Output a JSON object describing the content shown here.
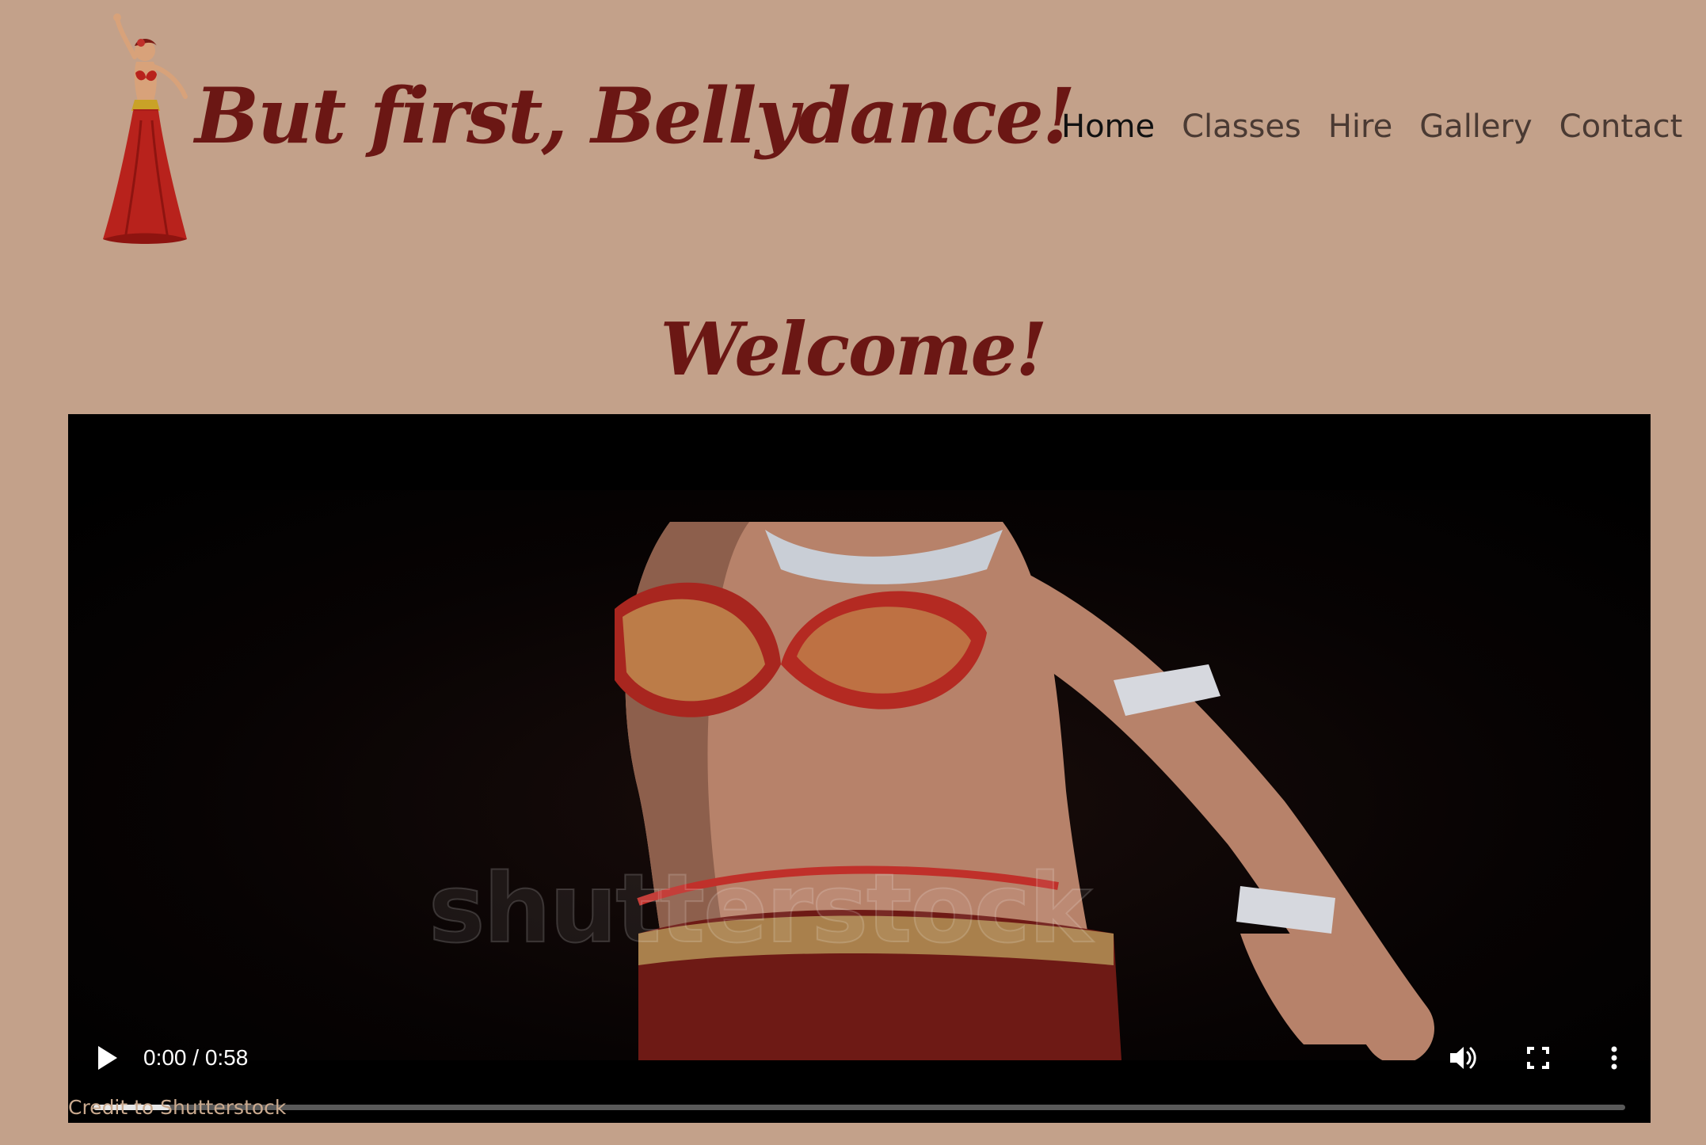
{
  "header": {
    "site_title": "But first, Bellydance!",
    "logo_icon": "bellydancer-icon"
  },
  "nav": {
    "items": [
      {
        "label": "Home",
        "active": true
      },
      {
        "label": "Classes",
        "active": false
      },
      {
        "label": "Hire",
        "active": false
      },
      {
        "label": "Gallery",
        "active": false
      },
      {
        "label": "Contact",
        "active": false
      }
    ]
  },
  "main": {
    "heading": "Welcome!"
  },
  "video": {
    "watermark": "shutterstock",
    "time": "0:00 / 0:58",
    "progress_fraction": 0.05,
    "icons": {
      "play": "play-icon",
      "volume": "volume-icon",
      "fullscreen": "fullscreen-icon",
      "more": "more-options-icon"
    },
    "credit": "Credit to Shutterstock"
  },
  "colors": {
    "background": "#c3a18a",
    "title": "#6b1714",
    "nav_active": "#111111",
    "nav_inactive": "#4a3a33"
  }
}
